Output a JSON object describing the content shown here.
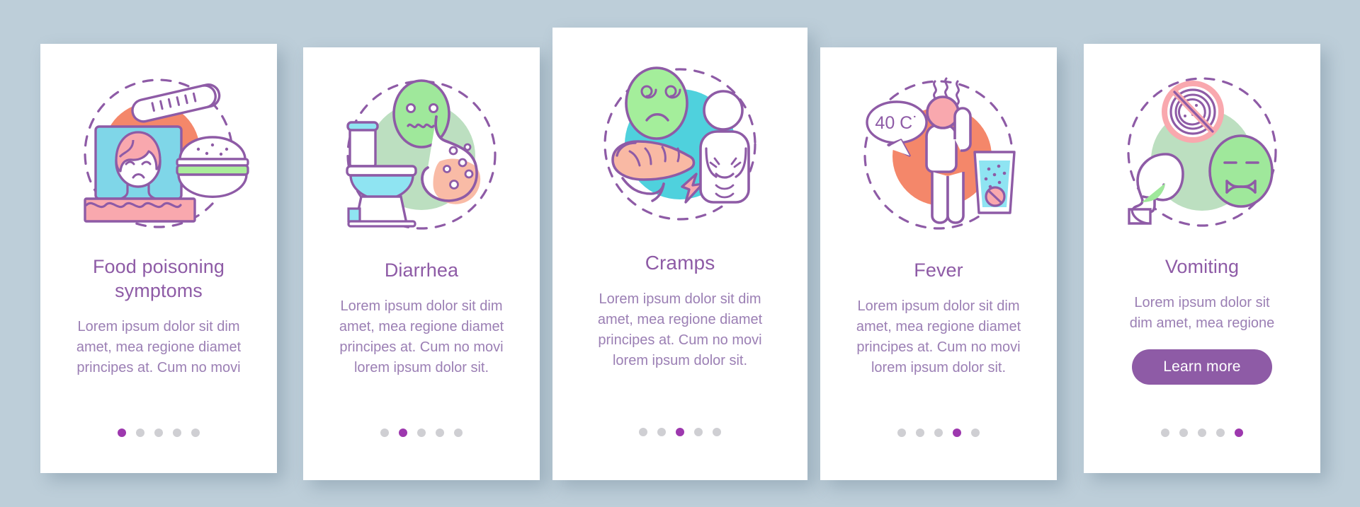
{
  "page": {
    "type": "onboarding-screens",
    "background_color": "#bdced9",
    "card_background_color": "#ffffff",
    "accent_color": "#8e5ba6",
    "title_color": "#8e5ba6",
    "body_color": "#9b7fb4",
    "dot_active_color": "#9d38ae",
    "dot_inactive_color": "#cfcfd3",
    "total_steps": 5
  },
  "cards": [
    {
      "id": "food-poisoning-symptoms",
      "title": "Food poisoning\nsymptoms",
      "title_lines": [
        "Food poisoning",
        "symptoms"
      ],
      "body_lines": [
        "Lorem ipsum dolor sit dim",
        "amet, mea regione diamet",
        "principes at. Cum no movi"
      ],
      "illustration": "sick-woman-in-bed-thermometer-burger-icon",
      "illustration_colors": {
        "circle": "#f4876a",
        "pillow": "#7fd6e8",
        "blanket": "#f9a8ae",
        "hair": "#f9a8ae",
        "bun": "#ffffff",
        "lettuce": "#aaed9a",
        "outline": "#8e5ba6"
      },
      "active_step": 1,
      "button": null
    },
    {
      "id": "diarrhea",
      "title": "Diarrhea",
      "title_lines": [
        "Diarrhea"
      ],
      "body_lines": [
        "Lorem ipsum dolor sit dim",
        "amet, mea regione diamet",
        "principes at. Cum no movi",
        "lorem ipsum dolor sit."
      ],
      "illustration": "toilet-sick-face-stomach-bacteria-icon",
      "illustration_colors": {
        "circle": "#bcdfc0",
        "face": "#9fe89b",
        "water": "#8fe4f2",
        "stomach": "#f9bba6",
        "outline": "#8e5ba6"
      },
      "active_step": 2,
      "button": null
    },
    {
      "id": "cramps",
      "title": "Cramps",
      "title_lines": [
        "Cramps"
      ],
      "body_lines": [
        "Lorem ipsum dolor sit dim",
        "amet, mea regione diamet",
        "principes at. Cum no movi",
        "lorem ipsum dolor sit."
      ],
      "illustration": "dizzy-face-pancreas-person-holding-stomach-lightning-icon",
      "illustration_colors": {
        "circle": "#4fd1dd",
        "face": "#a4ee9b",
        "organ": "#f9b9a4",
        "bolt": "#f9a8ae",
        "outline": "#8e5ba6"
      },
      "active_step": 3,
      "button": null
    },
    {
      "id": "fever",
      "title": "Fever",
      "title_lines": [
        "Fever"
      ],
      "body_lines": [
        "Lorem ipsum dolor sit dim",
        "amet, mea regione diamet",
        "principes at. Cum no movi",
        "lorem ipsum dolor sit."
      ],
      "illustration": "person-with-fever-speech-bubble-glass-icon",
      "speech_bubble_text": "40 C˙",
      "illustration_colors": {
        "circle": "#f4876a",
        "head": "#f9a8ae",
        "glass": "#8fe4f2",
        "outline": "#8e5ba6"
      },
      "active_step": 4,
      "button": null
    },
    {
      "id": "vomiting",
      "title": "Vomiting",
      "title_lines": [
        "Vomiting"
      ],
      "body_lines": [
        "Lorem ipsum dolor sit",
        "dim amet, mea regione"
      ],
      "illustration": "no-food-sign-head-vomiting-nauseous-face-icon",
      "illustration_colors": {
        "circle": "#bcdfc0",
        "face": "#9fe89b",
        "ban": "#f9a8ae",
        "vomit": "#9fe89b",
        "outline": "#8e5ba6"
      },
      "active_step": 5,
      "button": {
        "label": "Learn more"
      }
    }
  ]
}
